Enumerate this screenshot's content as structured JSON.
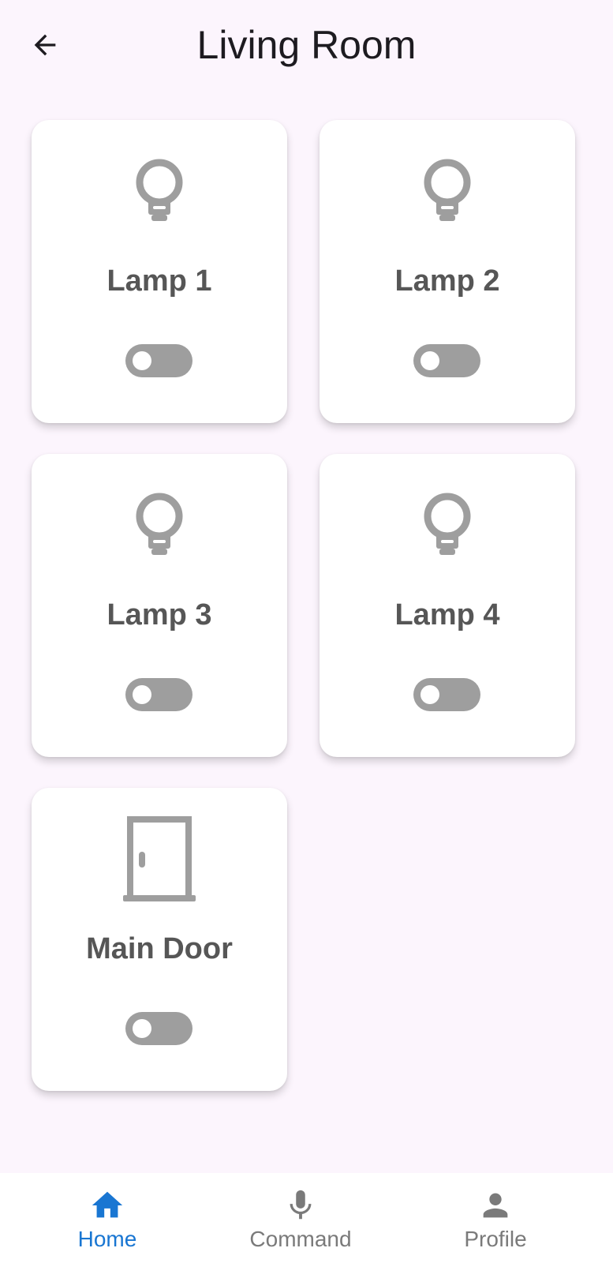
{
  "header": {
    "title": "Living Room",
    "back_icon": "arrow-left-icon"
  },
  "devices": [
    {
      "label": "Lamp 1",
      "icon": "lightbulb-icon",
      "on": false
    },
    {
      "label": "Lamp 2",
      "icon": "lightbulb-icon",
      "on": false
    },
    {
      "label": "Lamp 3",
      "icon": "lightbulb-icon",
      "on": false
    },
    {
      "label": "Lamp 4",
      "icon": "lightbulb-icon",
      "on": false
    },
    {
      "label": "Main Door",
      "icon": "door-icon",
      "on": false
    }
  ],
  "bottom_nav": {
    "items": [
      {
        "label": "Home",
        "icon": "home-icon",
        "active": true
      },
      {
        "label": "Command",
        "icon": "microphone-icon",
        "active": false
      },
      {
        "label": "Profile",
        "icon": "person-icon",
        "active": false
      }
    ]
  },
  "colors": {
    "background": "#fcf5fd",
    "card": "#ffffff",
    "icon_inactive": "#9e9e9e",
    "label_text": "#565656",
    "nav_active": "#1976d2",
    "nav_inactive": "#7a7a7a"
  }
}
